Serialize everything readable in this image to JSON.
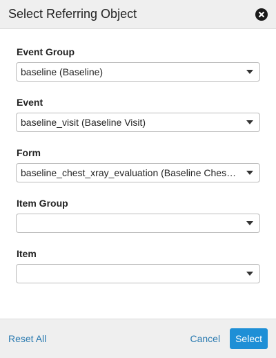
{
  "dialog": {
    "title": "Select Referring Object",
    "close_icon": "close-circle-icon"
  },
  "fields": [
    {
      "label": "Event Group",
      "value": "baseline (Baseline)"
    },
    {
      "label": "Event",
      "value": "baseline_visit (Baseline Visit)"
    },
    {
      "label": "Form",
      "value": "baseline_chest_xray_evaluation (Baseline Ches…"
    },
    {
      "label": "Item Group",
      "value": ""
    },
    {
      "label": "Item",
      "value": ""
    }
  ],
  "footer": {
    "reset_label": "Reset All",
    "cancel_label": "Cancel",
    "select_label": "Select"
  },
  "colors": {
    "accent": "#1e8fd6",
    "link": "#2a7ab0",
    "header_bg": "#efefef"
  }
}
